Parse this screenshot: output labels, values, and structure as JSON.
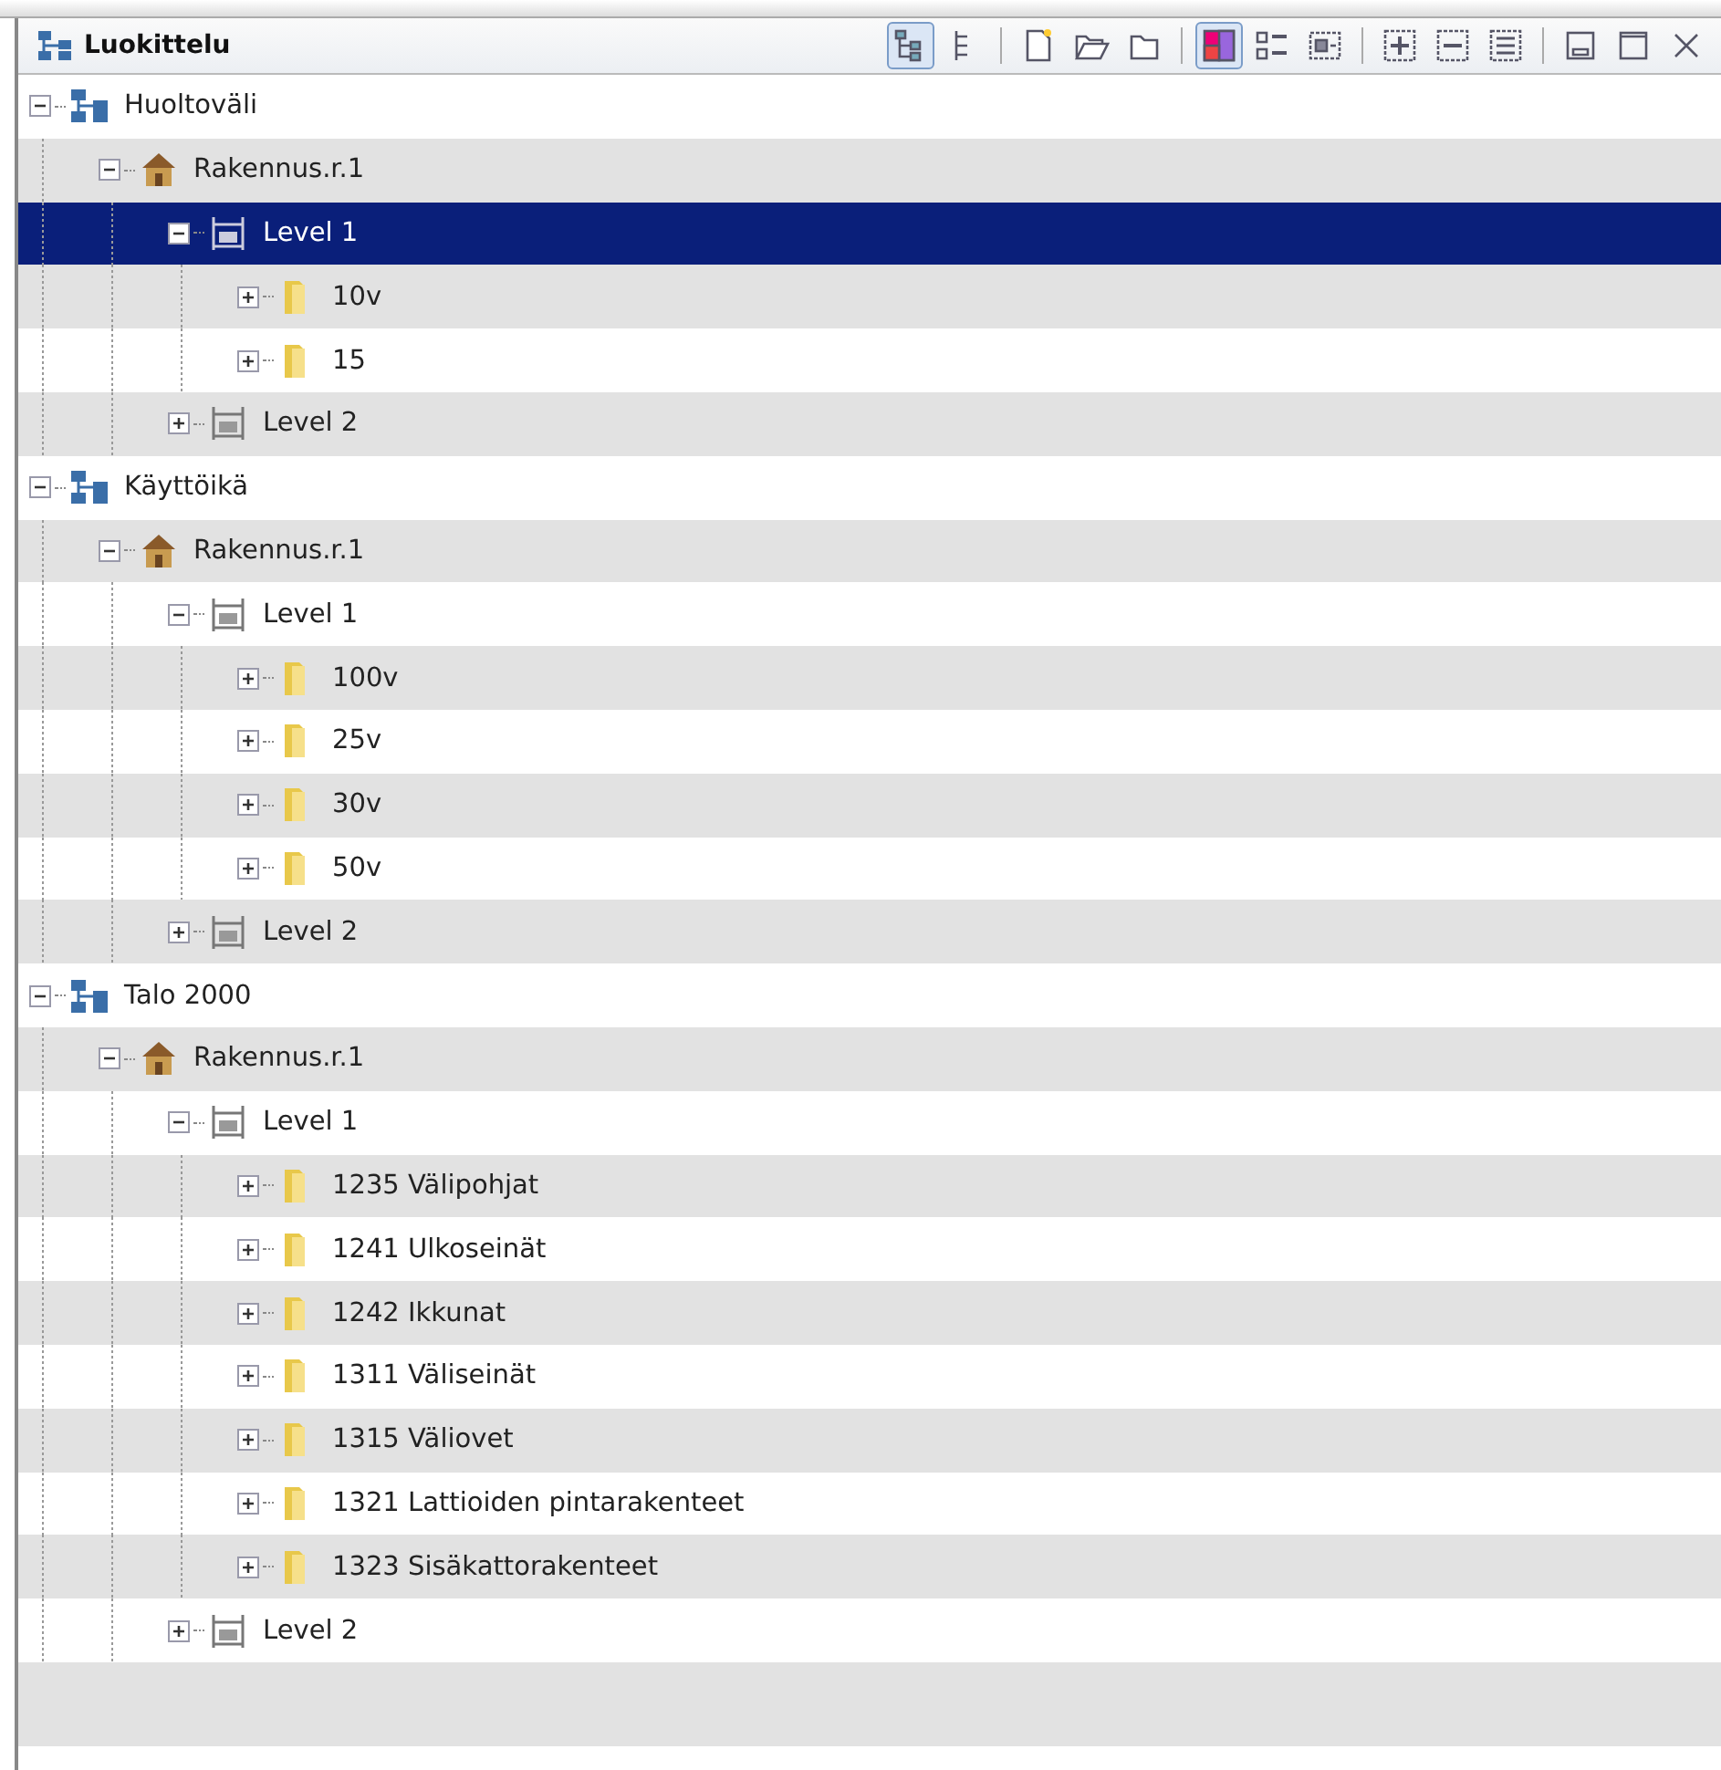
{
  "panel": {
    "title": "Luokittelu"
  },
  "toolbar": [
    {
      "kind": "tree-view",
      "on": true
    },
    {
      "kind": "flat-view",
      "on": false
    },
    {
      "kind": "sep"
    },
    {
      "kind": "new",
      "on": false
    },
    {
      "kind": "open",
      "on": false
    },
    {
      "kind": "folder",
      "on": false
    },
    {
      "kind": "sep"
    },
    {
      "kind": "color",
      "on": true
    },
    {
      "kind": "checklist",
      "on": false
    },
    {
      "kind": "checkbox",
      "on": false
    },
    {
      "kind": "sep"
    },
    {
      "kind": "expand",
      "on": false
    },
    {
      "kind": "collapse",
      "on": false
    },
    {
      "kind": "list",
      "on": false
    },
    {
      "kind": "sep"
    },
    {
      "kind": "minimize",
      "on": false
    },
    {
      "kind": "maximize",
      "on": false
    },
    {
      "kind": "close",
      "on": false
    }
  ],
  "tree": [
    {
      "label": "Huoltoväli",
      "kind": "category",
      "expanded": true,
      "selected": false,
      "children": [
        {
          "label": "Rakennus.r.1",
          "kind": "building",
          "expanded": true,
          "selected": false,
          "children": [
            {
              "label": "Level 1",
              "kind": "level",
              "expanded": true,
              "selected": true,
              "children": [
                {
                  "label": "10v",
                  "kind": "folder",
                  "expanded": false,
                  "selected": false
                },
                {
                  "label": "15",
                  "kind": "folder",
                  "expanded": false,
                  "selected": false
                }
              ]
            },
            {
              "label": "Level 2",
              "kind": "level",
              "expanded": false,
              "selected": false
            }
          ]
        }
      ]
    },
    {
      "label": "Käyttöikä",
      "kind": "category",
      "expanded": true,
      "selected": false,
      "children": [
        {
          "label": "Rakennus.r.1",
          "kind": "building",
          "expanded": true,
          "selected": false,
          "children": [
            {
              "label": "Level 1",
              "kind": "level",
              "expanded": true,
              "selected": false,
              "children": [
                {
                  "label": "100v",
                  "kind": "folder",
                  "expanded": false,
                  "selected": false
                },
                {
                  "label": "25v",
                  "kind": "folder",
                  "expanded": false,
                  "selected": false
                },
                {
                  "label": "30v",
                  "kind": "folder",
                  "expanded": false,
                  "selected": false
                },
                {
                  "label": "50v",
                  "kind": "folder",
                  "expanded": false,
                  "selected": false
                }
              ]
            },
            {
              "label": "Level 2",
              "kind": "level",
              "expanded": false,
              "selected": false
            }
          ]
        }
      ]
    },
    {
      "label": "Talo 2000",
      "kind": "category",
      "expanded": true,
      "selected": false,
      "children": [
        {
          "label": "Rakennus.r.1",
          "kind": "building",
          "expanded": true,
          "selected": false,
          "children": [
            {
              "label": "Level 1",
              "kind": "level",
              "expanded": true,
              "selected": false,
              "children": [
                {
                  "label": "1235 Välipohjat",
                  "kind": "folder",
                  "expanded": false,
                  "selected": false
                },
                {
                  "label": "1241 Ulkoseinät",
                  "kind": "folder",
                  "expanded": false,
                  "selected": false
                },
                {
                  "label": "1242 Ikkunat",
                  "kind": "folder",
                  "expanded": false,
                  "selected": false
                },
                {
                  "label": "1311 Väliseinät",
                  "kind": "folder",
                  "expanded": false,
                  "selected": false
                },
                {
                  "label": "1315 Väliovet",
                  "kind": "folder",
                  "expanded": false,
                  "selected": false
                },
                {
                  "label": "1321 Lattioiden pintarakenteet",
                  "kind": "folder",
                  "expanded": false,
                  "selected": false
                },
                {
                  "label": "1323 Sisäkattorakenteet",
                  "kind": "folder",
                  "expanded": false,
                  "selected": false
                }
              ]
            },
            {
              "label": "Level 2",
              "kind": "level",
              "expanded": false,
              "selected": false
            }
          ]
        }
      ]
    }
  ]
}
